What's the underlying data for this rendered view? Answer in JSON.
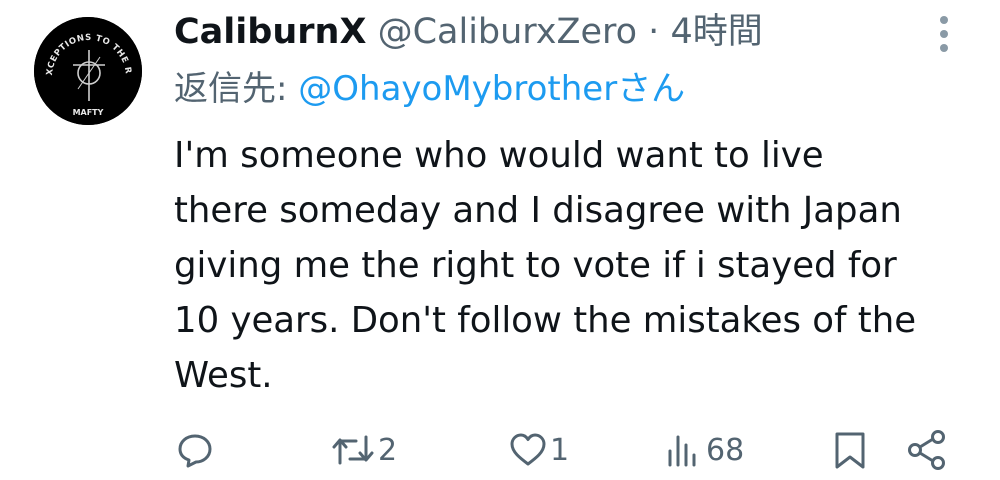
{
  "tweet": {
    "display_name": "CaliburnX",
    "handle": "@CaliburxZero",
    "separator": "·",
    "time": "4時間",
    "reply_prefix": "返信先: ",
    "reply_mention": "@OhayoMybrother",
    "reply_suffix": "さん",
    "text_lines": [
      "I'm someone who would want to live",
      "there someday and I disagree with Japan",
      "giving me the right to vote if i stayed for",
      "10 years.  Don't follow the mistakes of the",
      "West."
    ],
    "avatar": {
      "top_text": "NO EXCEPTIONS TO THE RULES",
      "bottom_text": "MAFTY"
    }
  },
  "actions": {
    "reply": {
      "icon": "reply-icon",
      "count": ""
    },
    "retweet": {
      "icon": "retweet-icon",
      "count": "2"
    },
    "like": {
      "icon": "heart-icon",
      "count": "1"
    },
    "views": {
      "icon": "views-icon",
      "count": "68"
    },
    "bookmark": {
      "icon": "bookmark-icon"
    },
    "share": {
      "icon": "share-icon"
    }
  },
  "colors": {
    "text": "#0f1419",
    "secondary": "#536471",
    "link": "#1d9bf0",
    "background": "#ffffff"
  }
}
